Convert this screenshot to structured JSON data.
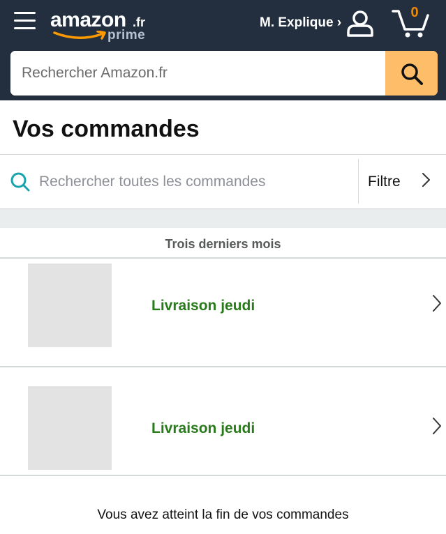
{
  "header": {
    "logo_word": "amazon",
    "logo_tld": ".fr",
    "logo_prime": "prime",
    "account_label": "M. Explique ›",
    "cart_count": "0"
  },
  "search": {
    "placeholder": "Rechercher Amazon.fr",
    "value": ""
  },
  "page": {
    "title": "Vos commandes"
  },
  "order_search": {
    "placeholder": "Rechercher toutes les commandes",
    "value": "",
    "filter_label": "Filtre"
  },
  "section": {
    "label": "Trois derniers mois"
  },
  "orders": [
    {
      "status": "Livraison jeudi"
    },
    {
      "status": "Livraison jeudi"
    }
  ],
  "footer": {
    "end_message": "Vous avez atteint la fin de vos commandes"
  },
  "icons": {
    "menu": "hamburger-menu-icon",
    "account": "user-icon",
    "cart": "cart-icon",
    "search": "magnifier-icon",
    "chevron": "chevron-right-icon"
  },
  "colors": {
    "header_bg": "#232f3e",
    "search_button": "#febd69",
    "cart_count": "#f08804",
    "status_green": "#287a1b",
    "search_icon_teal": "#1aa3ad"
  }
}
